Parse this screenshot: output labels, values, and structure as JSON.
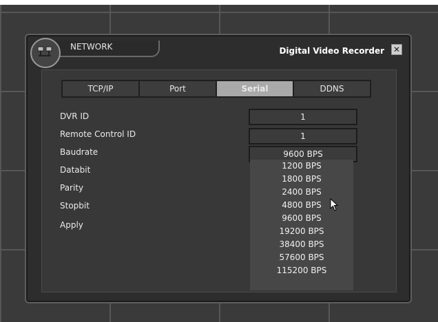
{
  "header": {
    "section_title": "NETWORK",
    "app_name": "Digital Video Recorder",
    "close_symbol": "✕"
  },
  "tabs": [
    {
      "label": "TCP/IP",
      "active": false
    },
    {
      "label": "Port",
      "active": false
    },
    {
      "label": "Serial",
      "active": true
    },
    {
      "label": "DDNS",
      "active": false
    }
  ],
  "fields": {
    "dvr_id": {
      "label": "DVR ID",
      "value": "1"
    },
    "remote_control_id": {
      "label": "Remote Control ID",
      "value": "1"
    },
    "baudrate": {
      "label": "Baudrate",
      "value": "9600 BPS"
    },
    "databit": {
      "label": "Databit"
    },
    "parity": {
      "label": "Parity"
    },
    "stopbit": {
      "label": "Stopbit"
    },
    "apply": {
      "label": "Apply"
    }
  },
  "baudrate_options": [
    "1200 BPS",
    "1800 BPS",
    "2400 BPS",
    "4800 BPS",
    "9600 BPS",
    "19200 BPS",
    "38400 BPS",
    "57600 BPS",
    "115200 BPS"
  ],
  "colors": {
    "background": "#3a3a3a",
    "window": "#2d2d2d",
    "active_tab": "#a9a9a9"
  }
}
